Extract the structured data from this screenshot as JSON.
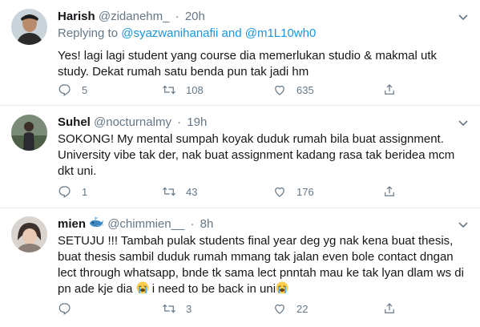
{
  "tweets": [
    {
      "name": "Harish",
      "handle": "@zidanehm_",
      "time": "20h",
      "reply_prefix": "Replying to",
      "reply_user1": "@syazwanihanafii",
      "reply_and": "and",
      "reply_user2": "@m1L10wh0",
      "text": "Yes! lagi lagi student yang course dia memerlukan studio & makmal utk study. Dekat rumah satu benda pun tak jadi hm",
      "replies": "5",
      "retweets": "108",
      "likes": "635"
    },
    {
      "name": "Suhel",
      "handle": "@nocturnalmy",
      "time": "19h",
      "text": "SOKONG! My mental sumpah koyak duduk rumah bila buat assignment. University vibe tak der, nak buat assignment kadang rasa tak beridea mcm dkt uni.",
      "replies": "1",
      "retweets": "43",
      "likes": "176"
    },
    {
      "name": "mien",
      "handle": "@chimmien__",
      "time": "8h",
      "text_part1": "SETUJU !!! Tambah pulak students final year deg yg nak kena buat thesis, buat thesis sambil duduk rumah mmang tak jalan even bole contact dngan lect through whatsapp, bnde tk sama lect pnntah mau ke tak lyan dlam ws di pn ade kje dia",
      "text_part2": "i need to be back in uni",
      "replies": "",
      "retweets": "3",
      "likes": "22"
    }
  ],
  "icons": {
    "reply": "reply-icon",
    "retweet": "retweet-icon",
    "like": "heart-icon",
    "share": "share-icon",
    "more": "chevron-down-icon",
    "whale": "whale-emoji-icon",
    "crying": "crying-face-emoji-icon"
  },
  "colors": {
    "link": "#1b95e0",
    "muted": "#657786",
    "text": "#14171a",
    "divider": "#e6ecf0"
  }
}
